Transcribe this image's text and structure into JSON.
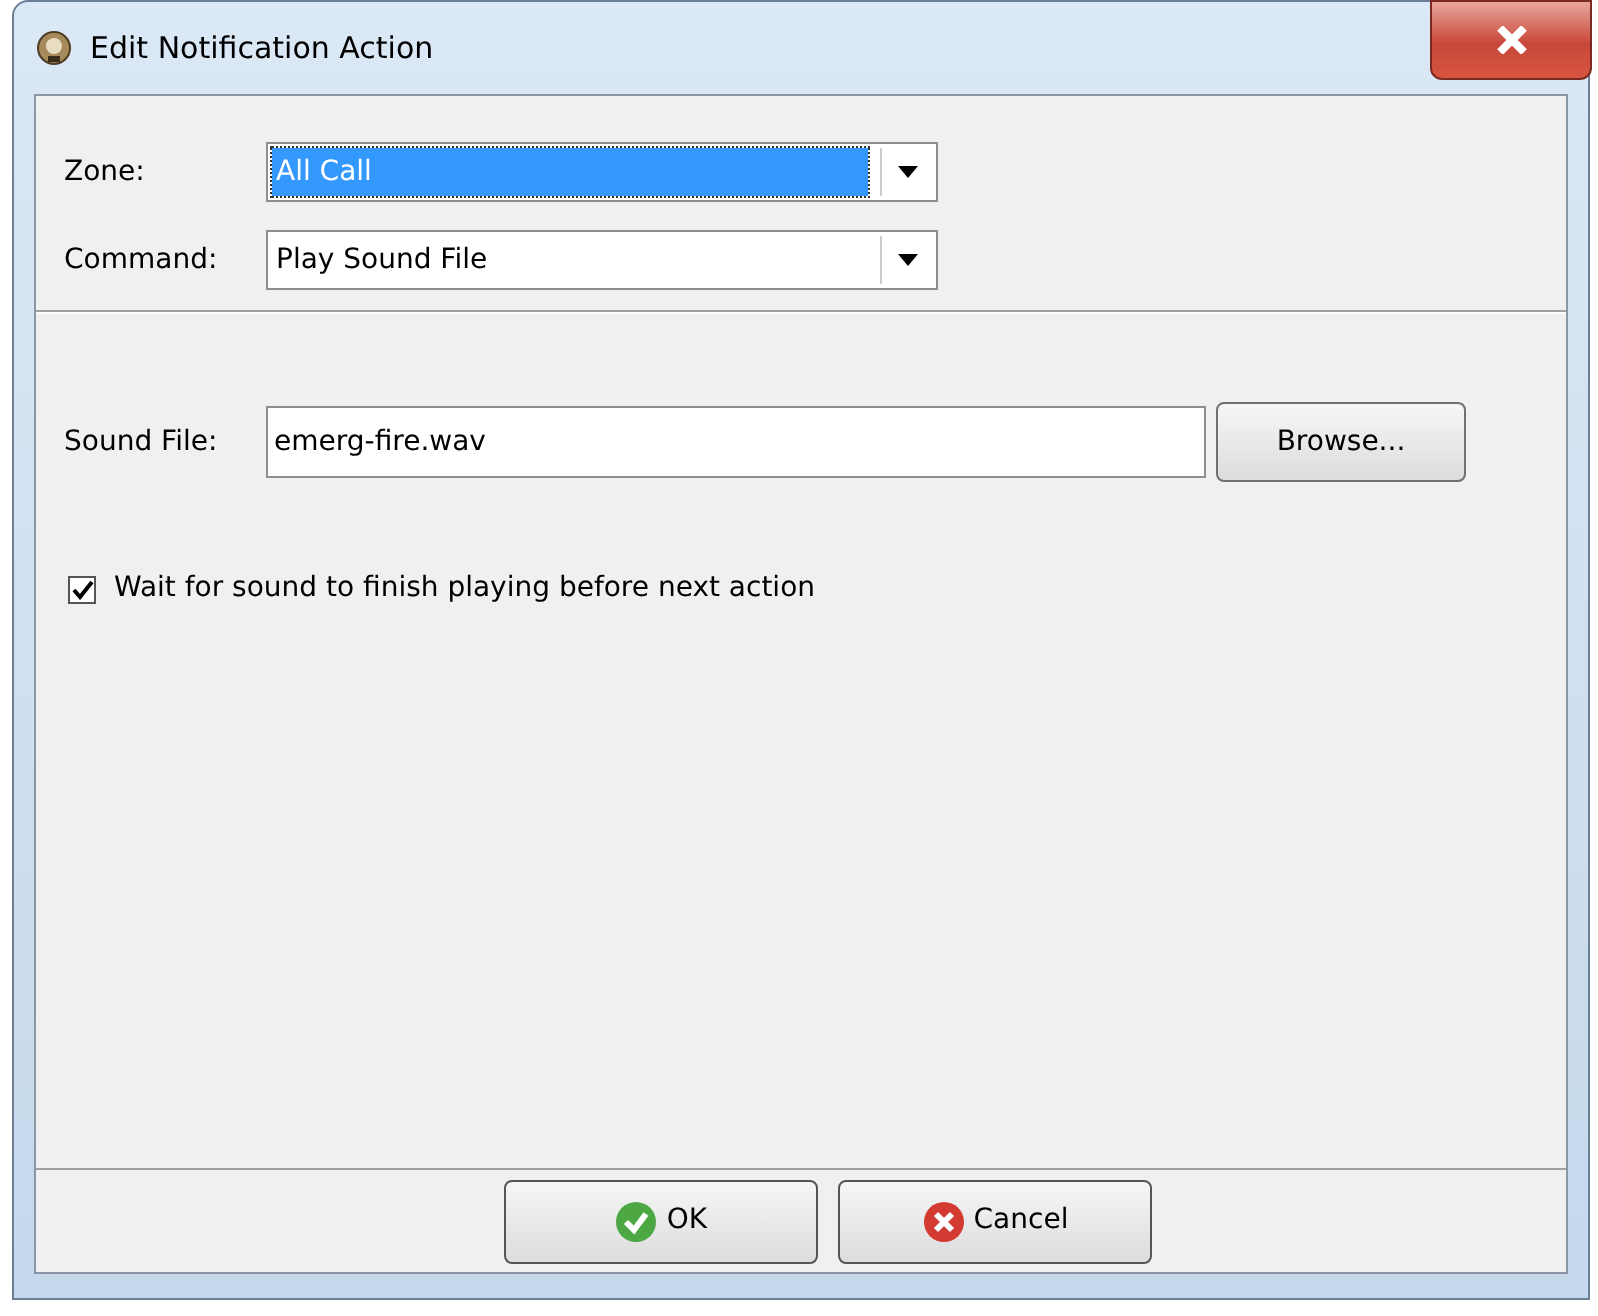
{
  "window": {
    "title": "Edit Notification Action"
  },
  "selectors": [
    {
      "label": "Zone:",
      "value": "All Call",
      "focused": true
    },
    {
      "label": "Command:",
      "value": "Play Sound File",
      "focused": false
    }
  ],
  "sound_file": {
    "label": "Sound File:",
    "value": "emerg-fire.wav",
    "browse": "Browse..."
  },
  "wait_option": {
    "label": "Wait for sound to finish playing before next action",
    "checked": true
  },
  "buttons": [
    {
      "kind": "ok",
      "label": "OK"
    },
    {
      "kind": "cancel",
      "label": "Cancel"
    }
  ]
}
